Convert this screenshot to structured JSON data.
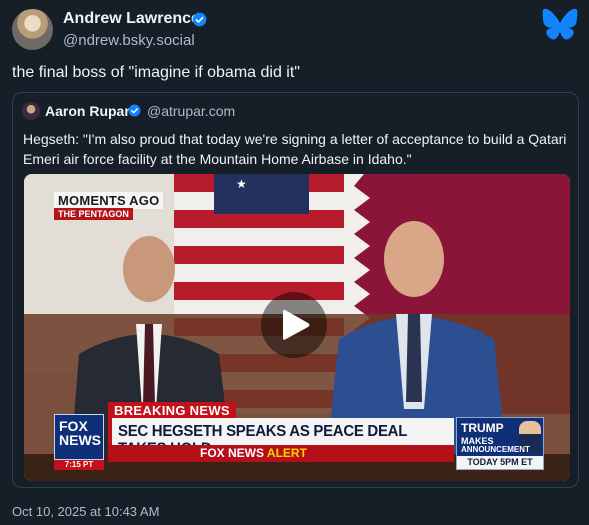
{
  "author": {
    "display_name": "Andrew Lawrence",
    "handle": "@ndrew.bsky.social",
    "verified_icon": "verified-badge-icon"
  },
  "post": {
    "text": "the final boss of \"imagine if obama did it\"",
    "timestamp": "Oct 10, 2025 at 10:43 AM"
  },
  "quoted_post": {
    "display_name": "Aaron Rupar",
    "handle": "@atrupar.com",
    "text": "Hegseth: \"I'm also proud that today we're signing a letter of acceptance to build a Qatari Emeri air force facility at the Mountain Home Airbase in Idaho.\""
  },
  "video": {
    "moments": "MOMENTS AGO",
    "location": "THE PENTAGON",
    "breaking": "BREAKING",
    "breaking_news": "NEWS",
    "headline": "SEC HEGSETH SPEAKS AS PEACE DEAL TAKES HOLD",
    "alert_brand": "FOX NEWS",
    "alert_word": "ALERT",
    "logo_line1": "FOX",
    "logo_line2": "NEWS",
    "logo_time": "7:15 PT",
    "promo_name": "TRUMP",
    "promo_line1": "MAKES",
    "promo_line2": "ANNOUNCEMENT",
    "promo_time": "TODAY 5PM ET"
  },
  "colors": {
    "background": "#161e27",
    "accent": "#1185fe",
    "text": "#f1f3f5",
    "muted": "#aebbc9",
    "border": "#2e4052"
  }
}
